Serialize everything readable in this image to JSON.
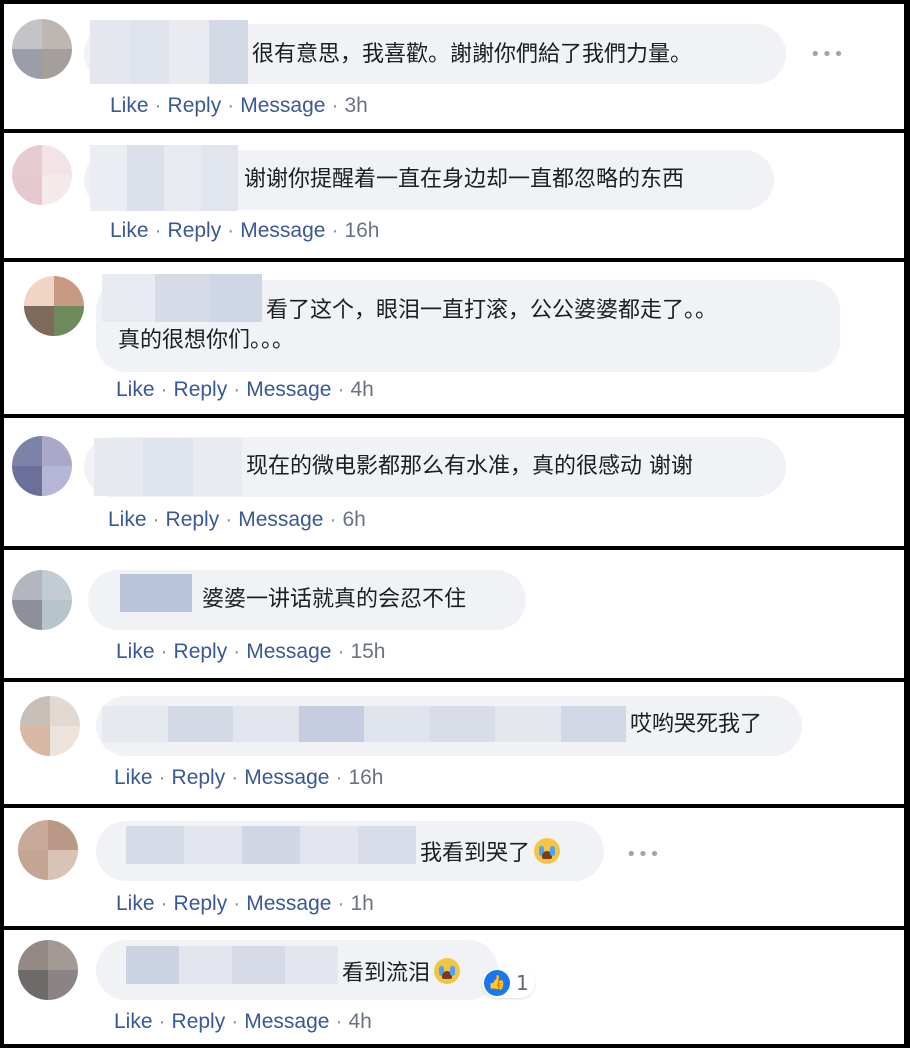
{
  "colors": {
    "link": "#385898",
    "bubble": "#f0f2f5",
    "text": "#1c1e21",
    "like_badge": "#1877f2"
  },
  "actions": {
    "like": "Like",
    "reply": "Reply",
    "message": "Message",
    "sep": "·"
  },
  "comments": [
    {
      "text": "很有意思，我喜歡。謝謝你們給了我們力量。",
      "time": "3h"
    },
    {
      "text": "谢谢你提醒着一直在身边却一直都忽略的东西",
      "time": "16h"
    },
    {
      "text_line1": "看了这个，眼泪一直打滚，公公婆婆都走了。。",
      "text_line2": "真的很想你们。。。",
      "time": "4h"
    },
    {
      "text": "现在的微电影都那么有水准，真的很感动 谢谢",
      "time": "6h"
    },
    {
      "text": "婆婆一讲话就真的会忍不住",
      "time": "15h"
    },
    {
      "text": "哎哟哭死我了",
      "time": "16h"
    },
    {
      "text": "我看到哭了",
      "emoji": "loudly-crying-face-icon",
      "time": "1h"
    },
    {
      "text": "看到流泪",
      "emoji": "loudly-crying-face-icon",
      "time": "4h",
      "reaction": {
        "icon": "like-icon",
        "count": "1"
      }
    }
  ]
}
